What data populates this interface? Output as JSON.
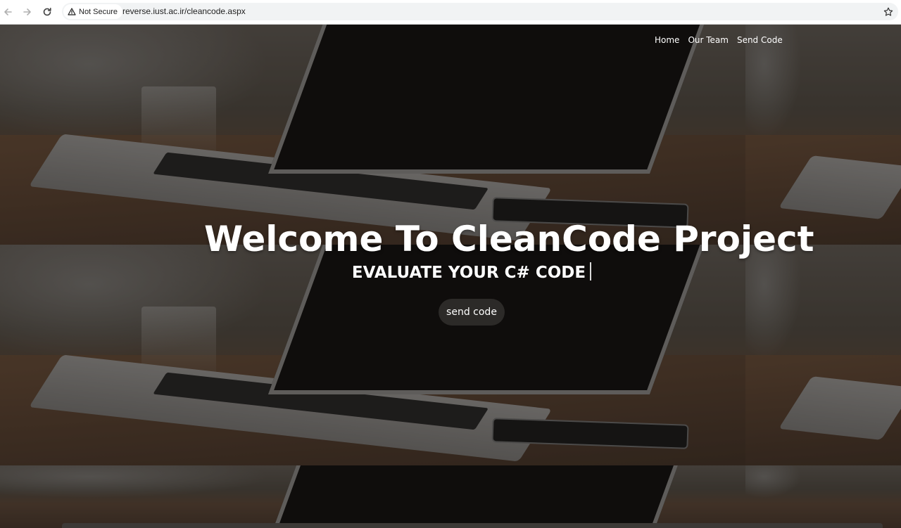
{
  "browser": {
    "security_label": "Not Secure",
    "url": "reverse.iust.ac.ir/cleancode.aspx",
    "icons": [
      "back-arrow-icon",
      "forward-arrow-icon",
      "reload-icon",
      "warning-triangle-icon",
      "bookmark-star-icon"
    ]
  },
  "nav": {
    "items": [
      {
        "label": "Home"
      },
      {
        "label": "Our Team"
      },
      {
        "label": "Send Code"
      }
    ]
  },
  "hero": {
    "title": "Welcome To CleanCode Project",
    "subtitle": "EVALUATE YOUR C# CODE",
    "button_label": "send code"
  },
  "colors": {
    "text": "#ffffff",
    "button_bg": "#2c2a28",
    "chrome_bg": "#ffffff",
    "omnibox_bg": "#f1f3f4"
  }
}
